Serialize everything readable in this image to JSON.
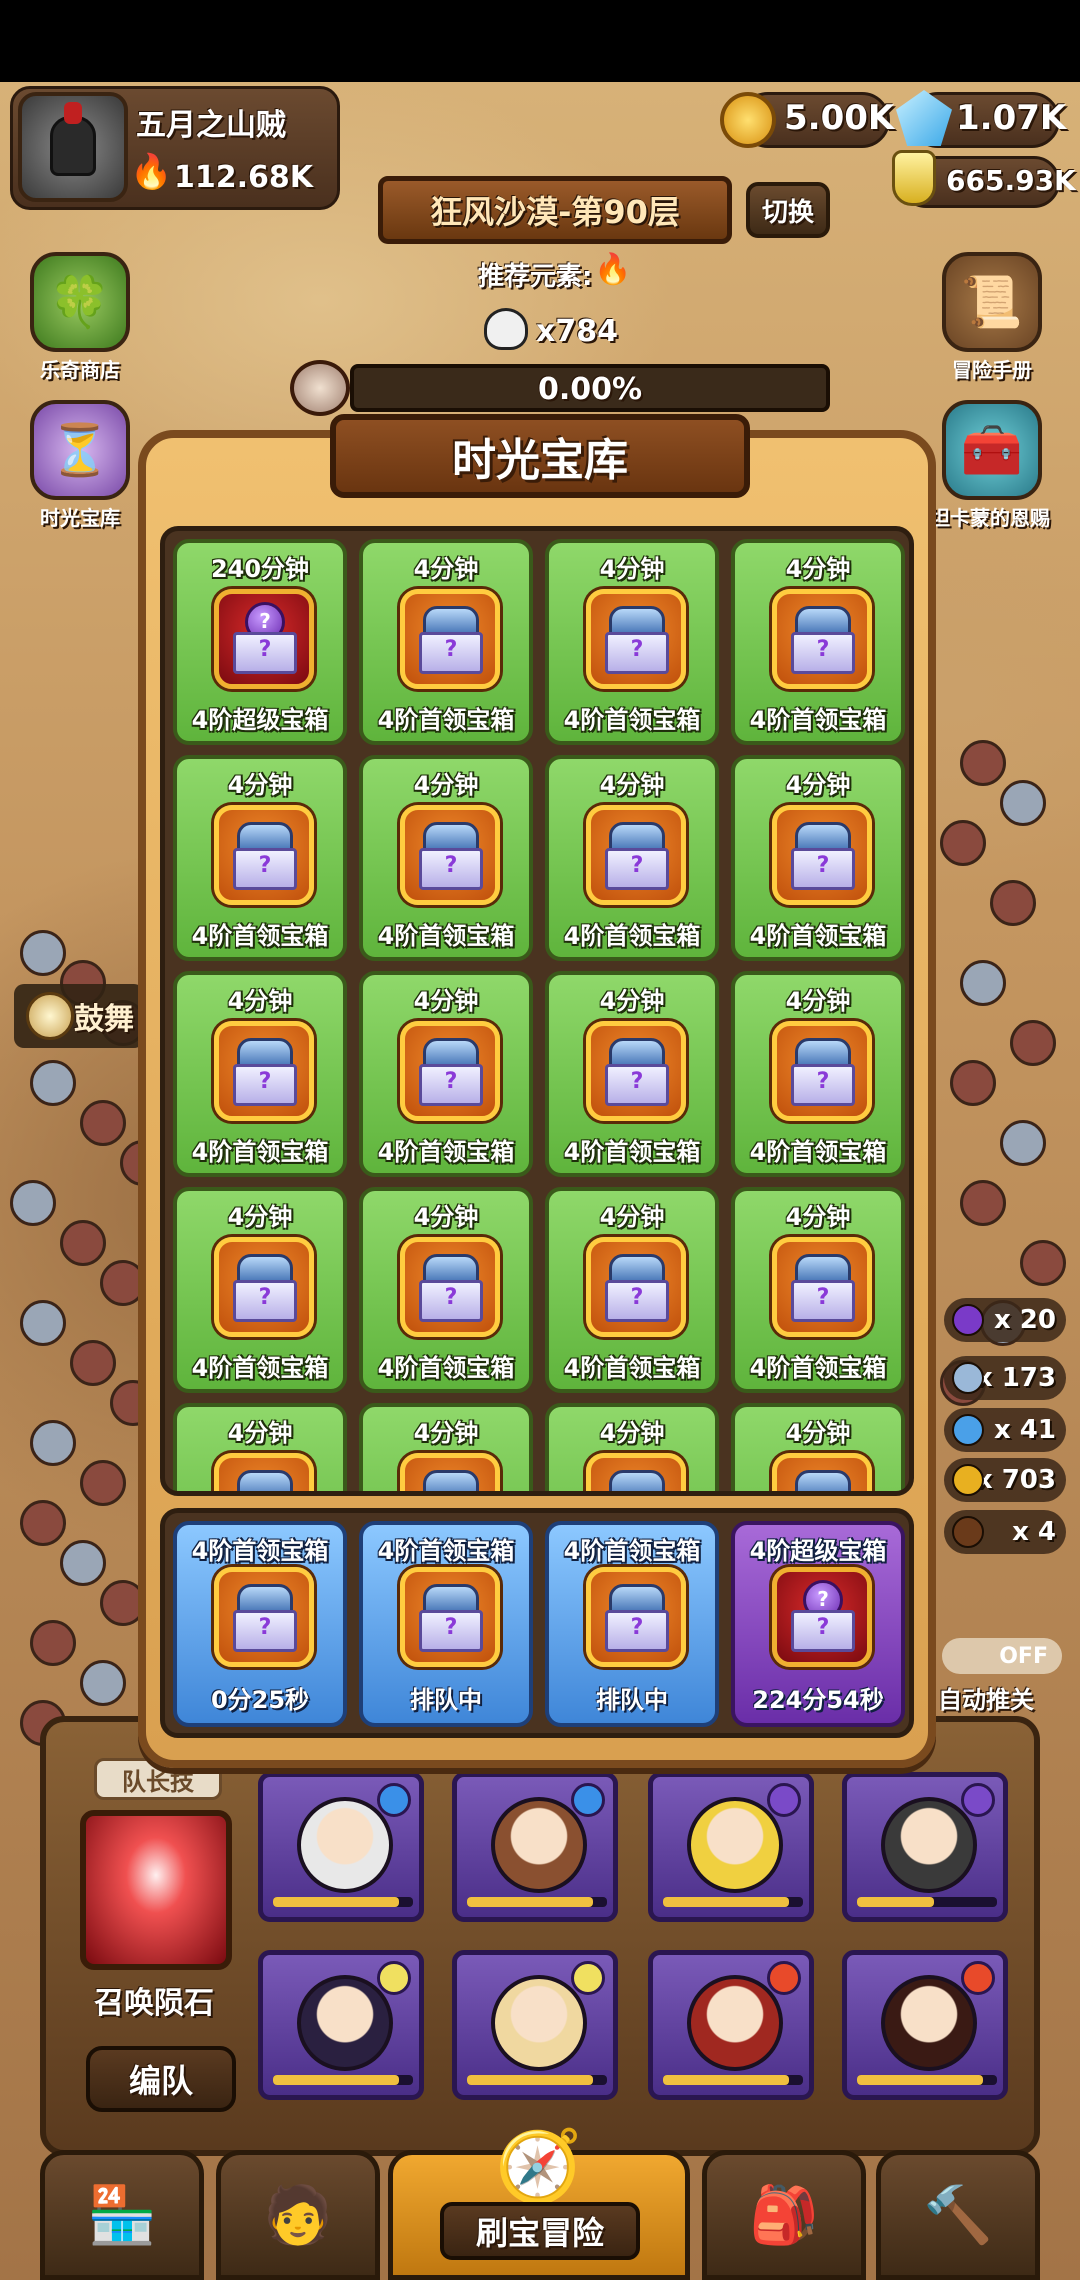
{
  "header": {
    "player_name": "五月之山贼",
    "power": "112.68K",
    "gold": "5.00K",
    "gems": "1.07K",
    "potion": "665.93K"
  },
  "stage": {
    "name": "狂风沙漠-第90层",
    "switch_label": "切换",
    "recommend_label": "推荐元素:",
    "enemy_count": "x784",
    "progress_text": "0.00%",
    "progress_fraction": 0.0
  },
  "side_left": [
    {
      "label": "乐奇商店",
      "icon": "clover-icon"
    },
    {
      "label": "时光宝库",
      "icon": "hourglass-icon"
    }
  ],
  "side_right": [
    {
      "label": "冒险手册",
      "icon": "scroll-icon"
    },
    {
      "label": "坦卡蒙的恩赐",
      "icon": "treasure-chest-icon"
    }
  ],
  "drum_label": "鼓舞",
  "modal": {
    "title": "时光宝库",
    "grid": [
      {
        "time": "240分钟",
        "name": "4阶超级宝箱",
        "type": "super"
      },
      {
        "time": "4分钟",
        "name": "4阶首领宝箱",
        "type": "boss"
      },
      {
        "time": "4分钟",
        "name": "4阶首领宝箱",
        "type": "boss"
      },
      {
        "time": "4分钟",
        "name": "4阶首领宝箱",
        "type": "boss"
      },
      {
        "time": "4分钟",
        "name": "4阶首领宝箱",
        "type": "boss"
      },
      {
        "time": "4分钟",
        "name": "4阶首领宝箱",
        "type": "boss"
      },
      {
        "time": "4分钟",
        "name": "4阶首领宝箱",
        "type": "boss"
      },
      {
        "time": "4分钟",
        "name": "4阶首领宝箱",
        "type": "boss"
      },
      {
        "time": "4分钟",
        "name": "4阶首领宝箱",
        "type": "boss"
      },
      {
        "time": "4分钟",
        "name": "4阶首领宝箱",
        "type": "boss"
      },
      {
        "time": "4分钟",
        "name": "4阶首领宝箱",
        "type": "boss"
      },
      {
        "time": "4分钟",
        "name": "4阶首领宝箱",
        "type": "boss"
      },
      {
        "time": "4分钟",
        "name": "4阶首领宝箱",
        "type": "boss"
      },
      {
        "time": "4分钟",
        "name": "4阶首领宝箱",
        "type": "boss"
      },
      {
        "time": "4分钟",
        "name": "4阶首领宝箱",
        "type": "boss"
      },
      {
        "time": "4分钟",
        "name": "4阶首领宝箱",
        "type": "boss"
      },
      {
        "time": "4分钟",
        "name": "",
        "type": "boss"
      },
      {
        "time": "4分钟",
        "name": "",
        "type": "boss"
      },
      {
        "time": "4分钟",
        "name": "",
        "type": "boss"
      },
      {
        "time": "4分钟",
        "name": "",
        "type": "boss"
      }
    ],
    "queue": [
      {
        "name": "4阶首领宝箱",
        "status": "0分25秒",
        "type": "boss",
        "color": "blue"
      },
      {
        "name": "4阶首领宝箱",
        "status": "排队中",
        "type": "boss",
        "color": "blue"
      },
      {
        "name": "4阶首领宝箱",
        "status": "排队中",
        "type": "boss",
        "color": "blue"
      },
      {
        "name": "4阶超级宝箱",
        "status": "224分54秒",
        "type": "super",
        "color": "purple"
      }
    ]
  },
  "right_counters": [
    {
      "value": "x 20",
      "icon": "purple-orb-icon"
    },
    {
      "value": "x 173",
      "icon": "crystal-icon"
    },
    {
      "value": "x 41",
      "icon": "blue-gem-icon"
    },
    {
      "value": "x 703",
      "icon": "coin-icon"
    },
    {
      "value": "x 4",
      "icon": "book-icon"
    }
  ],
  "auto_push": {
    "toggle": "OFF",
    "label": "自动推关"
  },
  "team": {
    "leader_skill_label": "队长技",
    "skill_name": "召唤陨石",
    "formation_button": "编队",
    "heroes_row1": [
      {
        "element": "water",
        "bar": 0.9
      },
      {
        "element": "water",
        "bar": 0.9
      },
      {
        "element": "wind",
        "bar": 0.9
      },
      {
        "element": "wind",
        "bar": 0.55
      }
    ],
    "heroes_row2": [
      {
        "element": "light",
        "bar": 0.9
      },
      {
        "element": "light",
        "bar": 0.9
      },
      {
        "element": "fire",
        "bar": 0.9
      },
      {
        "element": "fire",
        "bar": 0.9
      }
    ]
  },
  "nav": {
    "items": [
      "shop-icon",
      "hero-icon",
      "adventure-icon",
      "backpack-icon",
      "forge-icon"
    ],
    "adventure_label": "刷宝冒险"
  },
  "colors": {
    "accent_green": "#6cc44a",
    "queue_blue": "#3f86d8",
    "queue_purple": "#6a2ea8",
    "modal_gold": "#e6b060"
  }
}
